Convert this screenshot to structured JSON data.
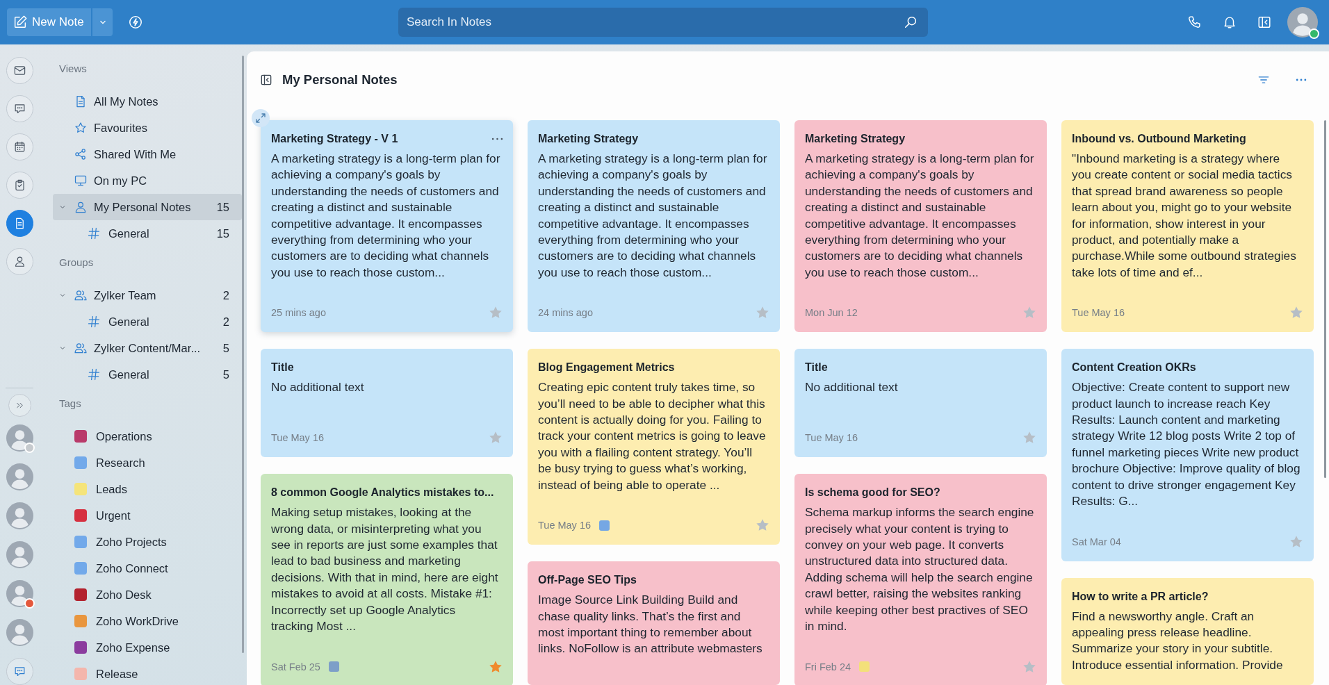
{
  "top_bar": {
    "new_note": {
      "label": "New Note"
    },
    "search": {
      "placeholder": "Search In Notes"
    },
    "user": {
      "status_dot": true,
      "color": "#35b86b"
    }
  },
  "rail": {
    "apps": [
      {
        "kind": "mail",
        "selected": false
      },
      {
        "kind": "chat",
        "selected": false
      },
      {
        "kind": "calendar",
        "selected": false
      },
      {
        "kind": "tasks",
        "selected": false
      },
      {
        "kind": "notes",
        "selected": true
      },
      {
        "kind": "contacts",
        "selected": false
      }
    ],
    "people": [
      {
        "status_dot": true,
        "color": "#c6cace"
      },
      {
        "status_dot": false
      },
      {
        "status_dot": false
      },
      {
        "status_dot": false
      },
      {
        "status_dot": true,
        "color": "#e4583c"
      },
      {
        "status_dot": false
      }
    ]
  },
  "sidebar": {
    "views": {
      "heading": "Views",
      "items": [
        {
          "kind": "all-notes",
          "label": "All My Notes",
          "selected": false
        },
        {
          "kind": "favourites",
          "label": "Favourites",
          "selected": false
        },
        {
          "kind": "shared",
          "label": "Shared With Me",
          "selected": false
        },
        {
          "kind": "pc",
          "label": "On my PC",
          "selected": false
        },
        {
          "kind": "personal",
          "label": "My Personal Notes",
          "count": "15",
          "selected": true,
          "expanded": true,
          "children": [
            {
              "kind": "channel",
              "label": "General",
              "count": "15",
              "selected": false
            }
          ]
        }
      ]
    },
    "groups": {
      "heading": "Groups",
      "items": [
        {
          "kind": "group",
          "label": "Zylker Team",
          "count": "2",
          "selected": false,
          "expanded": true,
          "children": [
            {
              "kind": "channel",
              "label": "General",
              "count": "2",
              "selected": false
            }
          ]
        },
        {
          "kind": "group",
          "label": "Zylker Content/Mar...",
          "count": "5",
          "selected": false,
          "expanded": true,
          "children": [
            {
              "kind": "channel",
              "label": "General",
              "count": "5",
              "selected": false
            }
          ]
        }
      ]
    },
    "tags": {
      "heading": "Tags",
      "items": [
        {
          "label": "Operations",
          "color": "#b93a6a"
        },
        {
          "label": "Research",
          "color": "#72a9ea"
        },
        {
          "label": "Leads",
          "color": "#f5e47a"
        },
        {
          "label": "Urgent",
          "color": "#d63040"
        },
        {
          "label": "Zoho Projects",
          "color": "#72a9ea"
        },
        {
          "label": "Zoho Connect",
          "color": "#72a9ea"
        },
        {
          "label": "Zoho Desk",
          "color": "#b3222e"
        },
        {
          "label": "Zoho WorkDrive",
          "color": "#e9963e"
        },
        {
          "label": "Zoho Expense",
          "color": "#8b3c9e"
        },
        {
          "label": "Release",
          "color": "#f4b6ac"
        }
      ]
    }
  },
  "notes_view": {
    "title": "My Personal Notes",
    "note_columns": [
      [
        {
          "title": "Marketing Strategy - V 1",
          "body": "A marketing strategy is a long-term plan for achieving a company's goals by understanding the needs of customers and creating a distinct and sustainable competitive advantage. It encompasses everything from determining who your customers are to deciding what channels you use to reach those custom...",
          "date": "25 mins ago",
          "color": "#c5e4f9",
          "starred": false,
          "hovered": true
        },
        {
          "title": "Title",
          "body": "No additional text",
          "date": "Tue May 16",
          "color": "#c5e4f9",
          "starred": false,
          "hovered": false
        },
        {
          "title": "8 common Google Analytics mistakes to...",
          "body": "Making setup mistakes, looking at the wrong data, or misinterpreting what you see in reports are just some examples that lead to bad business and marketing decisions. With that in mind, here are eight mistakes to avoid at all costs. Mistake #1: Incorrectly set up Google Analytics tracking Most ...",
          "date": "Sat Feb 25",
          "tag": {
            "color": "#7d9fc8"
          },
          "color": "#c9e6bd",
          "starred": true,
          "hovered": false
        }
      ],
      [
        {
          "title": "Marketing Strategy",
          "body": "A marketing strategy is a long-term plan for achieving a company's goals by understanding the needs of customers and creating a distinct and sustainable competitive advantage. It encompasses everything from determining who your customers are to deciding what channels you use to reach those custom...",
          "date": "24 mins ago",
          "color": "#c5e4f9",
          "starred": false,
          "hovered": false
        },
        {
          "title": "Blog Engagement Metrics",
          "body": "Creating epic content truly takes time, so you’ll need to be able to decipher what this content is actually doing for you. Failing to track your content metrics is going to leave you with a flailing content strategy. You’ll be busy trying to guess what’s working, instead of being able to operate ...",
          "date": "Tue May 16",
          "tag": {
            "color": "#75a7e4"
          },
          "color": "#fdedb0",
          "starred": false,
          "hovered": false
        },
        {
          "title": "Off-Page SEO Tips",
          "body": "Image Source Link Building Build and chase quality links. That’s the first and most important thing to remember about links. NoFollow is an attribute webmasters",
          "color": "#f7c0ca",
          "hovered": false
        }
      ],
      [
        {
          "title": "Marketing Strategy",
          "body": "A marketing strategy is a long-term plan for achieving a company's goals by understanding the needs of customers and creating a distinct and sustainable competitive advantage. It encompasses everything from determining who your customers are to deciding what channels you use to reach those custom...",
          "date": "Mon Jun 12",
          "color": "#f7c0ca",
          "starred": false,
          "hovered": false
        },
        {
          "title": "Title",
          "body": "No additional text",
          "date": "Tue May 16",
          "color": "#c5e4f9",
          "starred": false,
          "hovered": false
        },
        {
          "title": "Is schema good for SEO?",
          "body": "Schema markup informs the search engine precisely what your content is trying to convey on your web page. It converts unstructured data into structured data. Adding schema will help the search engine crawl better, raising the websites ranking while keeping other best practives of SEO in mind.",
          "date": "Fri Feb 24",
          "tag": {
            "color": "#f3e07a"
          },
          "color": "#f7c0ca",
          "starred": false,
          "hovered": false
        }
      ],
      [
        {
          "title": "Inbound vs. Outbound Marketing",
          "body": "\"Inbound marketing is a strategy where you create content or social media tactics that spread brand awareness so people learn about you, might go to your website for information, show interest in your product, and potentially make a purchase.While some outbound strategies take lots of time and ef...",
          "date": "Tue May 16",
          "color": "#fdedb0",
          "starred": false,
          "hovered": false
        },
        {
          "title": "Content Creation OKRs",
          "body": "Objective: Create content to support new product launch to increase reach Key Results: Launch content and marketing strategy Write 12 blog posts Write 2 top of funnel marketing pieces Write new product brochure Objective: Improve quality of blog content to drive stronger engagement Key Results: G...",
          "date": "Sat Mar 04",
          "color": "#c5e4f9",
          "starred": false,
          "hovered": false
        },
        {
          "title": "How to write a PR article?",
          "body": "Find a newsworthy angle. Craft an appealing press release headline. Summarize your story in your subtitle. Introduce essential information. Provide",
          "color": "#fdedb0",
          "hovered": false
        }
      ]
    ]
  }
}
